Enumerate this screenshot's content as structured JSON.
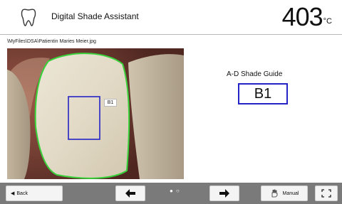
{
  "header": {
    "title": "Digital Shade Assistant",
    "temperature": "403",
    "temperature_unit": "°C"
  },
  "file_path": "\\MyFiles\\DSA\\Patientin Maries Meier.jpg",
  "selection_label": "B1",
  "result": {
    "guide_label": "A-D Shade Guide",
    "shade": "B1"
  },
  "toolbar": {
    "back_label": "Back",
    "prev_icon": "arrow-left-icon",
    "next_icon": "arrow-right-icon",
    "page_indicator": "● ○",
    "manual_label": "Manual",
    "fullscreen_icon": "fullscreen-icon"
  },
  "colors": {
    "outline_green": "#39d23a",
    "selection_blue": "#2323c6",
    "toolbar_gray": "#7a7a7a"
  }
}
